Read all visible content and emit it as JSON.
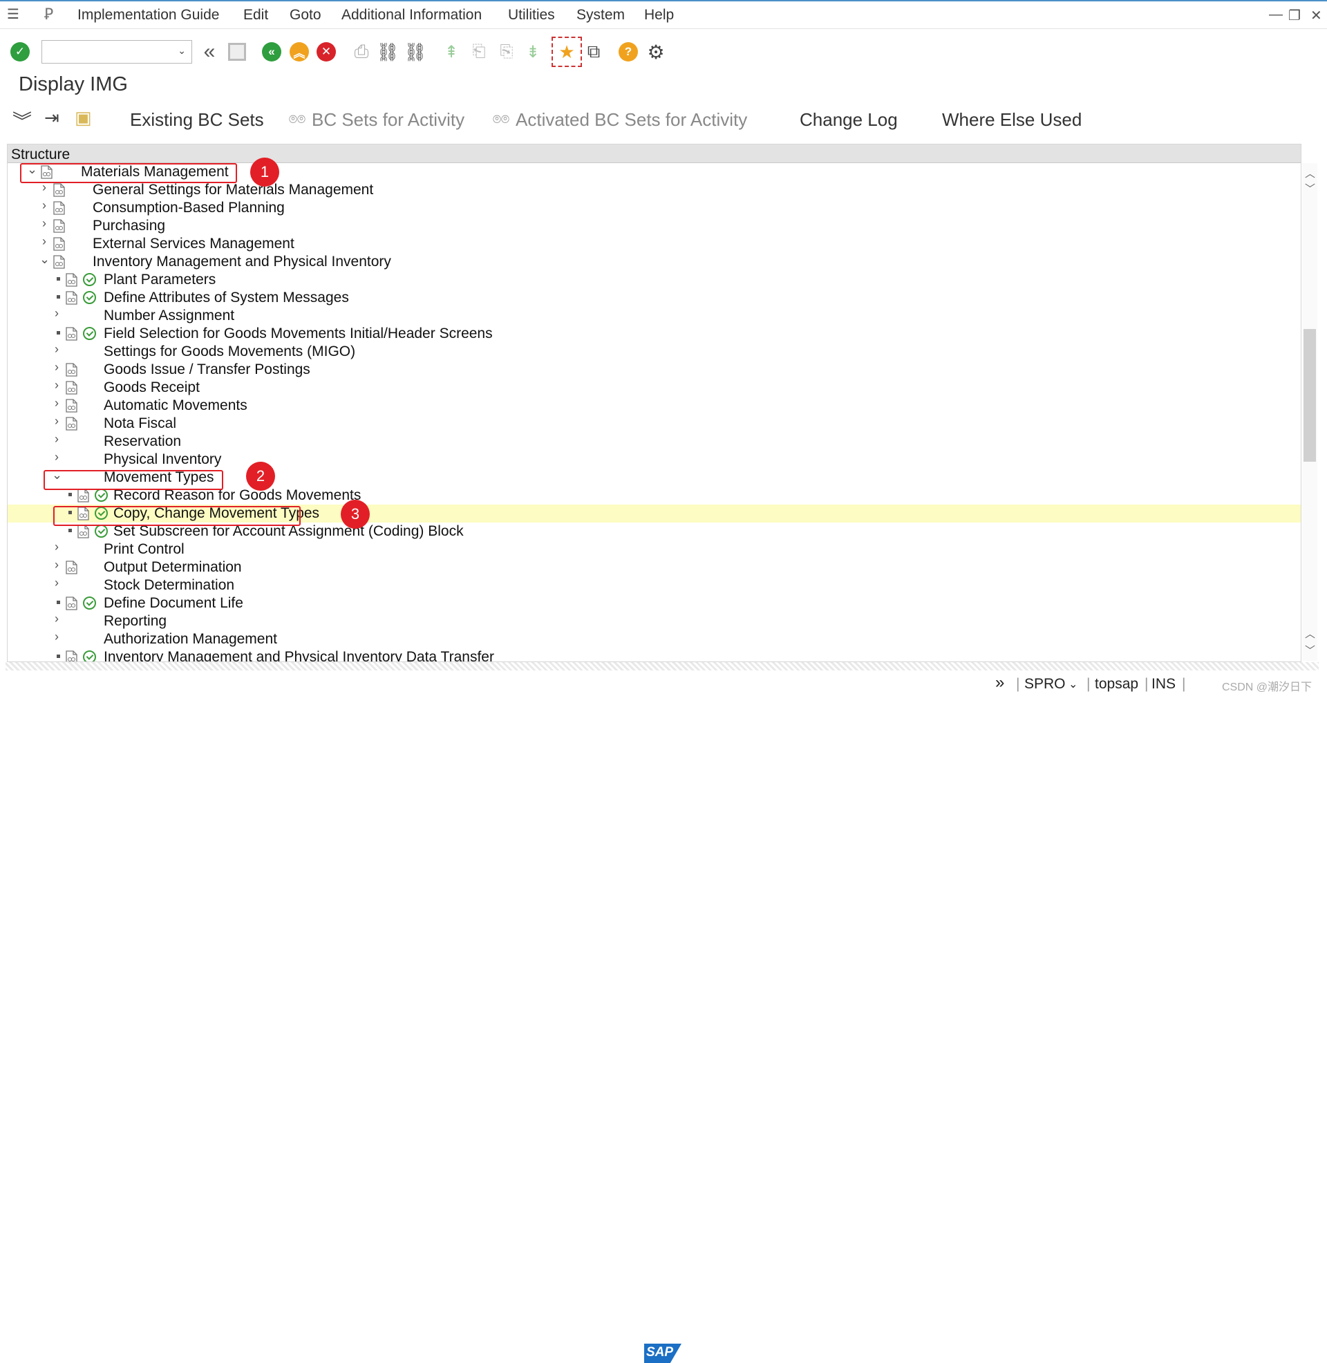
{
  "menu": {
    "items": [
      "Implementation Guide",
      "Edit",
      "Goto",
      "Additional Information",
      "Utilities",
      "System",
      "Help"
    ]
  },
  "window_controls": {
    "minimize": "—",
    "restore": "❐",
    "close": "✕"
  },
  "toolbar": {
    "command_field_value": ""
  },
  "page": {
    "title": "Display IMG"
  },
  "app_toolbar": {
    "existing_bc_sets": "Existing BC Sets",
    "bc_sets_for_activity": "BC Sets for Activity",
    "activated_bc_sets": "Activated BC Sets for Activity",
    "change_log": "Change Log",
    "where_else_used": "Where Else Used"
  },
  "structure": {
    "header": "Structure",
    "rows": [
      {
        "label": "Materials Management",
        "level": 0,
        "expander": "open",
        "icons": [
          "doc"
        ]
      },
      {
        "label": "General Settings for Materials Management",
        "level": 1,
        "expander": "closed",
        "icons": [
          "doc"
        ]
      },
      {
        "label": "Consumption-Based Planning",
        "level": 1,
        "expander": "closed",
        "icons": [
          "doc"
        ]
      },
      {
        "label": "Purchasing",
        "level": 1,
        "expander": "closed",
        "icons": [
          "doc"
        ]
      },
      {
        "label": "External Services Management",
        "level": 1,
        "expander": "closed",
        "icons": [
          "doc"
        ]
      },
      {
        "label": "Inventory Management and Physical Inventory",
        "level": 1,
        "expander": "open",
        "icons": [
          "doc"
        ]
      },
      {
        "label": "Plant Parameters",
        "level": 2,
        "expander": "leaf",
        "icons": [
          "doc",
          "clock"
        ]
      },
      {
        "label": "Define Attributes of System Messages",
        "level": 2,
        "expander": "leaf",
        "icons": [
          "doc",
          "clock"
        ]
      },
      {
        "label": "Number Assignment",
        "level": 2,
        "expander": "closed",
        "icons": []
      },
      {
        "label": "Field Selection for Goods Movements Initial/Header Screens",
        "level": 2,
        "expander": "leaf",
        "icons": [
          "doc",
          "clock"
        ]
      },
      {
        "label": "Settings for Goods Movements (MIGO)",
        "level": 2,
        "expander": "closed",
        "icons": []
      },
      {
        "label": "Goods Issue / Transfer Postings",
        "level": 2,
        "expander": "closed",
        "icons": [
          "doc"
        ]
      },
      {
        "label": "Goods Receipt",
        "level": 2,
        "expander": "closed",
        "icons": [
          "doc"
        ]
      },
      {
        "label": "Automatic Movements",
        "level": 2,
        "expander": "closed",
        "icons": [
          "doc"
        ]
      },
      {
        "label": "Nota Fiscal",
        "level": 2,
        "expander": "closed",
        "icons": [
          "doc"
        ]
      },
      {
        "label": "Reservation",
        "level": 2,
        "expander": "closed",
        "icons": []
      },
      {
        "label": "Physical Inventory",
        "level": 2,
        "expander": "closed",
        "icons": []
      },
      {
        "label": "Movement Types",
        "level": 2,
        "expander": "open",
        "icons": []
      },
      {
        "label": "Record Reason for Goods Movements",
        "level": 3,
        "expander": "leaf",
        "icons": [
          "doc",
          "clock"
        ]
      },
      {
        "label": "Copy, Change Movement Types",
        "level": 3,
        "expander": "leaf",
        "icons": [
          "doc",
          "clock"
        ],
        "selected": true
      },
      {
        "label": "Set Subscreen for Account Assignment (Coding) Block",
        "level": 3,
        "expander": "leaf",
        "icons": [
          "doc",
          "clock"
        ]
      },
      {
        "label": "Print Control",
        "level": 2,
        "expander": "closed",
        "icons": []
      },
      {
        "label": "Output Determination",
        "level": 2,
        "expander": "closed",
        "icons": [
          "doc"
        ]
      },
      {
        "label": "Stock Determination",
        "level": 2,
        "expander": "closed",
        "icons": []
      },
      {
        "label": "Define Document Life",
        "level": 2,
        "expander": "leaf",
        "icons": [
          "doc",
          "clock"
        ]
      },
      {
        "label": "Reporting",
        "level": 2,
        "expander": "closed",
        "icons": []
      },
      {
        "label": "Authorization Management",
        "level": 2,
        "expander": "closed",
        "icons": []
      },
      {
        "label": "Inventory Management and Physical Inventory Data Transfer",
        "level": 2,
        "expander": "leaf",
        "icons": [
          "doc",
          "clock"
        ]
      }
    ]
  },
  "annotations": [
    "1",
    "2",
    "3"
  ],
  "status_bar": {
    "logo": "SAP",
    "transaction": "SPRO",
    "server": "topsap",
    "mode": "INS",
    "watermark": "CSDN @潮汐日下"
  },
  "colors": {
    "highlight_red": "#e21f26",
    "selected_row": "#fdfcc2",
    "ok_green": "#2e9e3e",
    "exit_orange": "#f0a21e",
    "cancel_red": "#d8232a"
  }
}
